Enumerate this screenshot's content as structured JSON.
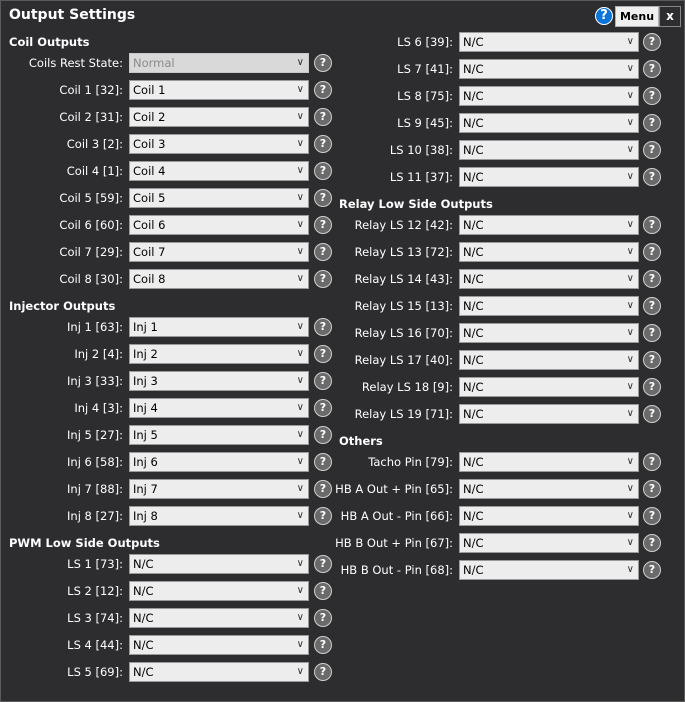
{
  "window": {
    "title": "Output Settings",
    "menu_label": "Menu",
    "close_label": "x",
    "help_glyph": "?"
  },
  "left": {
    "coil": {
      "header": "Coil Outputs",
      "rest_state": {
        "label": "Coils Rest State:",
        "value": "Normal"
      },
      "rows": [
        {
          "label": "Coil 1 [32]:",
          "value": "Coil 1"
        },
        {
          "label": "Coil 2 [31]:",
          "value": "Coil 2"
        },
        {
          "label": "Coil 3 [2]:",
          "value": "Coil 3"
        },
        {
          "label": "Coil 4 [1]:",
          "value": "Coil 4"
        },
        {
          "label": "Coil 5 [59]:",
          "value": "Coil 5"
        },
        {
          "label": "Coil 6 [60]:",
          "value": "Coil 6"
        },
        {
          "label": "Coil 7 [29]:",
          "value": "Coil 7"
        },
        {
          "label": "Coil 8 [30]:",
          "value": "Coil 8"
        }
      ]
    },
    "injector": {
      "header": "Injector Outputs",
      "rows": [
        {
          "label": "Inj 1 [63]:",
          "value": "Inj 1"
        },
        {
          "label": "Inj 2 [4]:",
          "value": "Inj 2"
        },
        {
          "label": "Inj 3 [33]:",
          "value": "Inj 3"
        },
        {
          "label": "Inj 4 [3]:",
          "value": "Inj 4"
        },
        {
          "label": "Inj 5 [27]:",
          "value": "Inj 5"
        },
        {
          "label": "Inj 6 [58]:",
          "value": "Inj 6"
        },
        {
          "label": "Inj 7 [88]:",
          "value": "Inj 7"
        },
        {
          "label": "Inj 8 [27]:",
          "value": "Inj 8"
        }
      ]
    },
    "pwm": {
      "header": "PWM Low Side Outputs",
      "rows": [
        {
          "label": "LS 1 [73]:",
          "value": "N/C"
        },
        {
          "label": "LS 2 [12]:",
          "value": "N/C"
        },
        {
          "label": "LS 3 [74]:",
          "value": "N/C"
        },
        {
          "label": "LS 4 [44]:",
          "value": "N/C"
        },
        {
          "label": "LS 5 [69]:",
          "value": "N/C"
        }
      ]
    }
  },
  "right": {
    "pwm_cont": {
      "rows": [
        {
          "label": "LS 6 [39]:",
          "value": "N/C"
        },
        {
          "label": "LS 7 [41]:",
          "value": "N/C"
        },
        {
          "label": "LS 8 [75]:",
          "value": "N/C"
        },
        {
          "label": "LS 9 [45]:",
          "value": "N/C"
        },
        {
          "label": "LS 10 [38]:",
          "value": "N/C"
        },
        {
          "label": "LS 11 [37]:",
          "value": "N/C"
        }
      ]
    },
    "relay": {
      "header": "Relay Low Side Outputs",
      "rows": [
        {
          "label": "Relay LS 12 [42]:",
          "value": "N/C"
        },
        {
          "label": "Relay LS 13 [72]:",
          "value": "N/C"
        },
        {
          "label": "Relay LS 14 [43]:",
          "value": "N/C"
        },
        {
          "label": "Relay LS 15 [13]:",
          "value": "N/C"
        },
        {
          "label": "Relay LS 16 [70]:",
          "value": "N/C"
        },
        {
          "label": "Relay LS 17 [40]:",
          "value": "N/C"
        },
        {
          "label": "Relay LS 18 [9]:",
          "value": "N/C"
        },
        {
          "label": "Relay LS 19 [71]:",
          "value": "N/C"
        }
      ]
    },
    "others": {
      "header": "Others",
      "rows": [
        {
          "label": "Tacho Pin [79]:",
          "value": "N/C"
        },
        {
          "label": "HB A Out + Pin [65]:",
          "value": "N/C"
        },
        {
          "label": "HB A Out - Pin [66]:",
          "value": "N/C"
        },
        {
          "label": "HB B Out + Pin [67]:",
          "value": "N/C"
        },
        {
          "label": "HB B Out - Pin [68]:",
          "value": "N/C"
        }
      ]
    }
  },
  "icons": {
    "help": "help-circle-icon",
    "dropdown": "chevron-down-icon"
  }
}
